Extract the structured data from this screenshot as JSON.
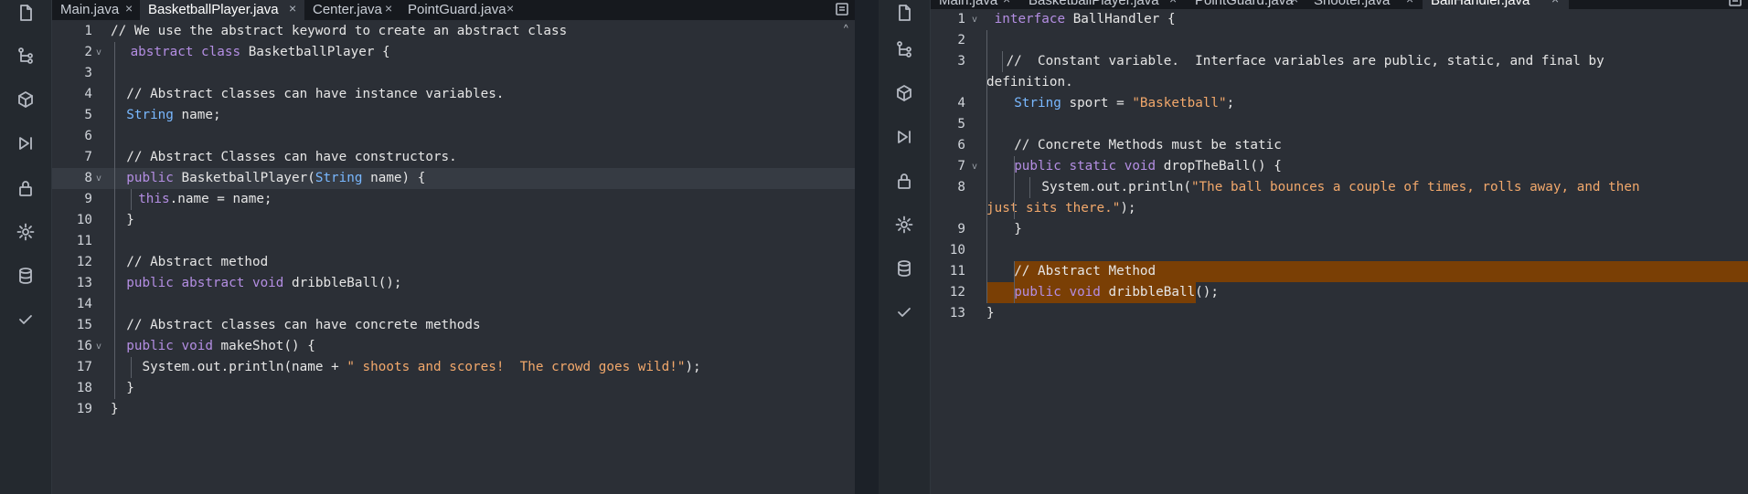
{
  "left": {
    "tabs": [
      {
        "label": "Main.java",
        "active": false
      },
      {
        "label": "BasketballPlayer.java",
        "active": true
      },
      {
        "label": "Center.java",
        "active": false
      },
      {
        "label": "PointGuard.java",
        "active": false
      }
    ],
    "close_glyph": "×",
    "fold_glyph": "v",
    "scroll_glyph": "^",
    "lines": [
      {
        "n": "1",
        "fold": false,
        "segs": [
          {
            "t": "// We use the abstract keyword to create an abstract class",
            "c": ""
          }
        ]
      },
      {
        "n": "2",
        "fold": true,
        "segs": [
          {
            "t": "abstract",
            "c": "kw"
          },
          {
            "t": " class ",
            "c": "kw"
          },
          {
            "t": "BasketballPlayer {",
            "c": ""
          }
        ]
      },
      {
        "n": "3",
        "fold": false,
        "segs": []
      },
      {
        "n": "4",
        "fold": false,
        "segs": [
          {
            "t": "// Abstract classes can have instance variables.",
            "c": ""
          }
        ]
      },
      {
        "n": "5",
        "fold": false,
        "segs": [
          {
            "t": "String",
            "c": "ty"
          },
          {
            "t": " name;",
            "c": ""
          }
        ]
      },
      {
        "n": "6",
        "fold": false,
        "segs": []
      },
      {
        "n": "7",
        "fold": false,
        "segs": [
          {
            "t": "// Abstract Classes can have constructors.",
            "c": ""
          }
        ]
      },
      {
        "n": "8",
        "fold": true,
        "segs": [
          {
            "t": "public",
            "c": "kw"
          },
          {
            "t": " BasketballPlayer(",
            "c": ""
          },
          {
            "t": "String",
            "c": "ty"
          },
          {
            "t": " name) {",
            "c": ""
          }
        ]
      },
      {
        "n": "9",
        "fold": false,
        "segs": [
          {
            "t": "this",
            "c": "kw"
          },
          {
            "t": ".name = name;",
            "c": ""
          }
        ]
      },
      {
        "n": "10",
        "fold": false,
        "segs": [
          {
            "t": "}",
            "c": ""
          }
        ]
      },
      {
        "n": "11",
        "fold": false,
        "segs": []
      },
      {
        "n": "12",
        "fold": false,
        "segs": [
          {
            "t": "// Abstract method",
            "c": ""
          }
        ]
      },
      {
        "n": "13",
        "fold": false,
        "segs": [
          {
            "t": "public abstract void",
            "c": "kw"
          },
          {
            "t": " dribbleBall();",
            "c": ""
          }
        ]
      },
      {
        "n": "14",
        "fold": false,
        "segs": []
      },
      {
        "n": "15",
        "fold": false,
        "segs": [
          {
            "t": "// Abstract classes can have concrete methods",
            "c": ""
          }
        ]
      },
      {
        "n": "16",
        "fold": true,
        "segs": [
          {
            "t": "public void",
            "c": "kw"
          },
          {
            "t": " makeShot() {",
            "c": ""
          }
        ]
      },
      {
        "n": "17",
        "fold": false,
        "segs": [
          {
            "t": "System.out.println(name + ",
            "c": ""
          },
          {
            "t": "\" shoots and scores!  The crowd goes wild!\"",
            "c": "st"
          },
          {
            "t": ");",
            "c": ""
          }
        ]
      },
      {
        "n": "18",
        "fold": false,
        "segs": [
          {
            "t": "}",
            "c": ""
          }
        ]
      },
      {
        "n": "19",
        "fold": false,
        "segs": [
          {
            "t": "}",
            "c": ""
          }
        ]
      }
    ]
  },
  "right": {
    "tabs": [
      {
        "label": "Main.java",
        "active": false
      },
      {
        "label": "BasketballPlayer.java",
        "active": false
      },
      {
        "label": "PointGuard.java",
        "active": false
      },
      {
        "label": "Shooter.java",
        "active": false
      },
      {
        "label": "BallHandler.java",
        "active": true
      }
    ],
    "close_glyph": "×",
    "fold_glyph": "v",
    "lines": [
      {
        "n": "1",
        "fold": true,
        "segs": [
          {
            "t": "interface",
            "c": "kw"
          },
          {
            "t": " BallHandler {",
            "c": ""
          }
        ]
      },
      {
        "n": "2",
        "fold": false,
        "segs": []
      },
      {
        "n": "3",
        "fold": false,
        "segs": [
          {
            "t": "//  Constant variable.  Interface variables are public, static, and final by",
            "c": ""
          }
        ]
      },
      {
        "n": "",
        "fold": false,
        "segs": [
          {
            "t": "definition.",
            "c": ""
          }
        ]
      },
      {
        "n": "4",
        "fold": false,
        "segs": [
          {
            "t": "String",
            "c": "ty"
          },
          {
            "t": " sport = ",
            "c": ""
          },
          {
            "t": "\"Basketball\"",
            "c": "st"
          },
          {
            "t": ";",
            "c": ""
          }
        ]
      },
      {
        "n": "5",
        "fold": false,
        "segs": []
      },
      {
        "n": "6",
        "fold": false,
        "segs": [
          {
            "t": "// Concrete Methods must be static",
            "c": ""
          }
        ]
      },
      {
        "n": "7",
        "fold": true,
        "segs": [
          {
            "t": "public static void",
            "c": "kw"
          },
          {
            "t": " dropTheBall() {",
            "c": ""
          }
        ]
      },
      {
        "n": "8",
        "fold": false,
        "segs": [
          {
            "t": "System.out.println(",
            "c": ""
          },
          {
            "t": "\"The ball bounces a couple of times, rolls away, and then",
            "c": "st"
          }
        ]
      },
      {
        "n": "",
        "fold": false,
        "segs": [
          {
            "t": "just sits there.\"",
            "c": "st"
          },
          {
            "t": ");",
            "c": ""
          }
        ]
      },
      {
        "n": "9",
        "fold": false,
        "segs": [
          {
            "t": "}",
            "c": ""
          }
        ]
      },
      {
        "n": "10",
        "fold": false,
        "segs": []
      },
      {
        "n": "11",
        "fold": false,
        "segs": [
          {
            "t": "// Abstract Method",
            "c": ""
          }
        ]
      },
      {
        "n": "12",
        "fold": false,
        "segs": [
          {
            "t": "public void",
            "c": "kw"
          },
          {
            "t": " dribbleBall();",
            "c": ""
          }
        ]
      },
      {
        "n": "13",
        "fold": false,
        "segs": [
          {
            "t": "}",
            "c": ""
          }
        ]
      }
    ]
  },
  "colors": {
    "selection": "#7a3f05",
    "keyword": "#b48ee3",
    "type": "#79b8ff",
    "string": "#f2a86b"
  }
}
